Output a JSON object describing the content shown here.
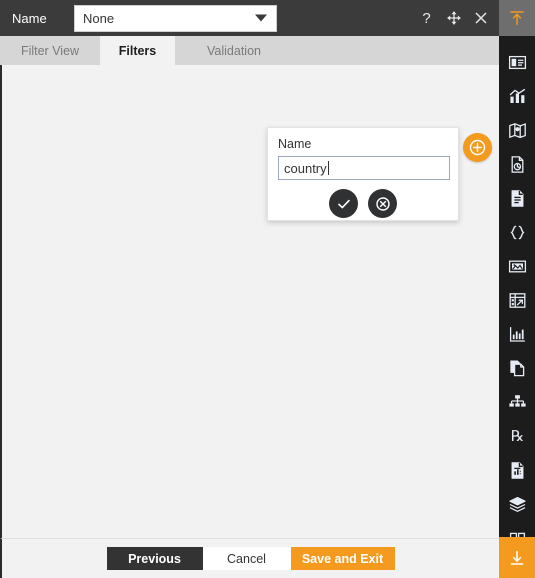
{
  "window": {
    "name_label": "Name",
    "selected_filter": "None",
    "dropdown_icon": "chevron-down-icon",
    "controls": [
      {
        "name": "help-icon",
        "glyph": "?"
      },
      {
        "name": "move-icon",
        "glyph": "move"
      },
      {
        "name": "close-icon",
        "glyph": "×"
      }
    ]
  },
  "tabs": [
    {
      "label": "Filter View",
      "active": false
    },
    {
      "label": "Filters",
      "active": true
    },
    {
      "label": "Validation",
      "active": false
    }
  ],
  "popup": {
    "field_label": "Name",
    "input_value": "country",
    "input_placeholder": "",
    "confirm_icon": "check-icon",
    "cancel_icon": "cancel-circle-icon"
  },
  "add_button": {
    "icon": "plus-circle-icon",
    "color": "#f49a1e"
  },
  "footer": {
    "previous_label": "Previous",
    "cancel_label": "Cancel",
    "save_label": "Save and Exit"
  },
  "rail": {
    "top_icon": "upload-arrow-icon",
    "bottom_icon": "download-arrow-icon",
    "items": [
      {
        "icon": "panel-layout-icon"
      },
      {
        "icon": "bar-chart-icon"
      },
      {
        "icon": "map-pin-icon"
      },
      {
        "icon": "document-refresh-icon"
      },
      {
        "icon": "document-text-icon"
      },
      {
        "icon": "curly-braces-icon"
      },
      {
        "icon": "image-icon"
      },
      {
        "icon": "table-icon"
      },
      {
        "icon": "line-chart-icon"
      },
      {
        "icon": "copy-pages-icon"
      },
      {
        "icon": "hierarchy-icon"
      },
      {
        "icon": "prescription-rx-icon"
      },
      {
        "icon": "document-chart-icon"
      },
      {
        "icon": "layers-icon"
      },
      {
        "icon": "grid-squares-icon"
      }
    ]
  },
  "colors": {
    "accent": "#f49a1e",
    "topbar": "#3b3b3b",
    "rail": "#1c1c1c",
    "content": "#f2f2f2"
  }
}
